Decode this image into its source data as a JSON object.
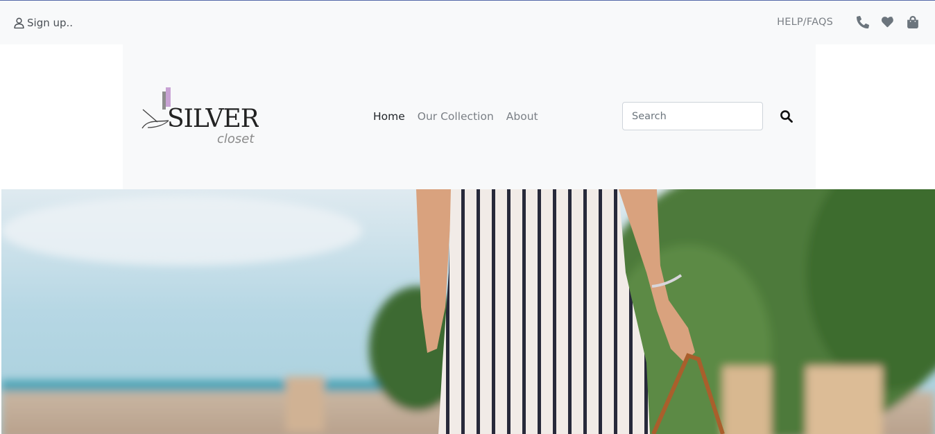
{
  "topbar": {
    "signup_label": "Sign up..",
    "help_label": "HELP/FAQS",
    "icons": [
      "phone-icon",
      "heart-icon",
      "shopping-bag-icon"
    ]
  },
  "brand": {
    "logo_text": "SILVER",
    "logo_subtext": "closet",
    "accent_color": "#c8a2d4"
  },
  "nav": {
    "items": [
      {
        "label": "Home",
        "active": true
      },
      {
        "label": "Our Collection",
        "active": false
      },
      {
        "label": "About",
        "active": false
      }
    ]
  },
  "search": {
    "placeholder": "Search",
    "value": ""
  },
  "colors": {
    "topbar_bg": "#f8f9fa",
    "muted_text": "#7a7f85",
    "active_text": "#212529"
  }
}
